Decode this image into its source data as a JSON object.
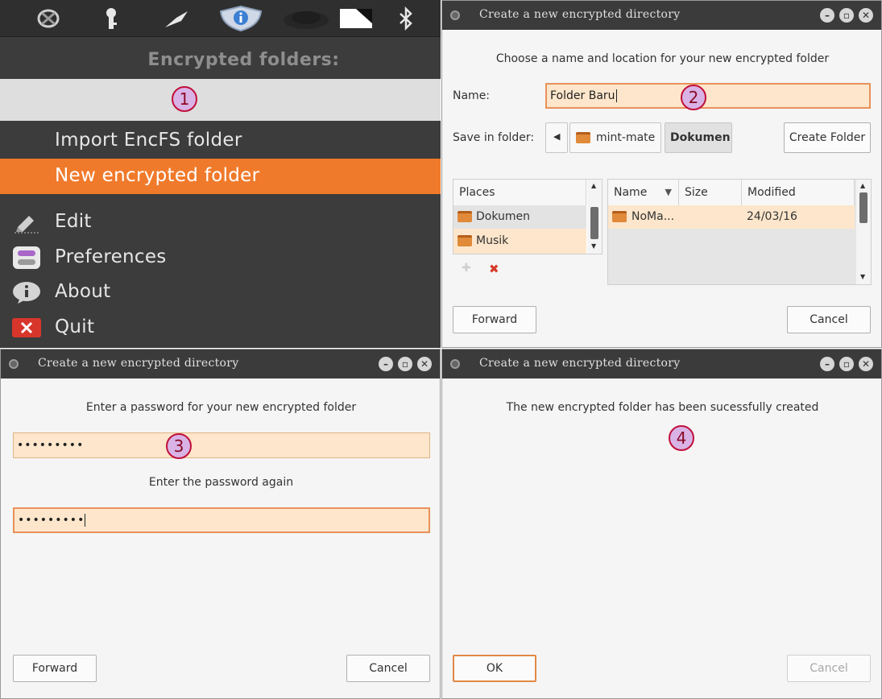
{
  "tray_menu": {
    "header": "Encrypted folders:",
    "folder_placeholder_marker": "1",
    "items": [
      {
        "label": "Import EncFS folder",
        "icon": "none"
      },
      {
        "label": "New encrypted folder",
        "icon": "none",
        "active": true
      },
      {
        "label": "Edit",
        "icon": "pen-icon"
      },
      {
        "label": "Preferences",
        "icon": "preferences-icon"
      },
      {
        "label": "About",
        "icon": "info-icon"
      },
      {
        "label": "Quit",
        "icon": "quit-icon"
      }
    ],
    "tray_icons": [
      "spiral-icon",
      "key-icon",
      "pin-icon",
      "shield-info-icon",
      "cloud-icon",
      "screen-icon",
      "bluetooth-icon"
    ]
  },
  "dialog_create": {
    "title": "Create a new encrypted directory",
    "intro": "Choose a name and location for your new encrypted folder",
    "name_label": "Name:",
    "name_value": "Folder Baru",
    "marker": "2",
    "save_in_label": "Save in folder:",
    "breadcrumbs": [
      "mint-mate",
      "Dokumen"
    ],
    "create_folder_button": "Create Folder",
    "places_header": "Places",
    "places": [
      "Dokumen",
      "Musik"
    ],
    "file_columns": [
      "Name",
      "Size",
      "Modified"
    ],
    "files": [
      {
        "name": "NoMa...",
        "size": "",
        "modified": "24/03/16"
      }
    ],
    "forward_button": "Forward",
    "cancel_button": "Cancel"
  },
  "dialog_password": {
    "title": "Create a new encrypted directory",
    "prompt": "Enter a password for your new encrypted folder",
    "password_value": "•••••••••",
    "marker": "3",
    "prompt_again": "Enter the password again",
    "password_again_value": "•••••••••",
    "forward_button": "Forward",
    "cancel_button": "Cancel"
  },
  "dialog_done": {
    "title": "Create a new encrypted directory",
    "message": "The new encrypted folder has been sucessfully created",
    "marker": "4",
    "ok_button": "OK",
    "cancel_button": "Cancel"
  },
  "colors": {
    "accent": "#f07a2b",
    "field_bg": "#fde6cb",
    "marker_fill": "#d9b3e6",
    "marker_border": "#c0103a"
  }
}
